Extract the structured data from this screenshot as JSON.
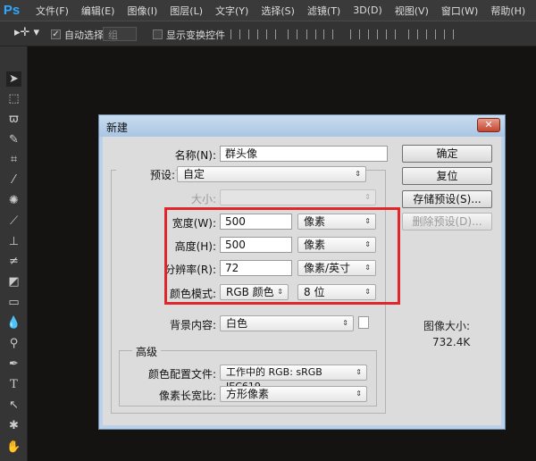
{
  "app": {
    "logo": "Ps",
    "menus": [
      "文件(F)",
      "编辑(E)",
      "图像(I)",
      "图层(L)",
      "文字(Y)",
      "选择(S)",
      "滤镜(T)",
      "3D(D)",
      "视图(V)",
      "窗口(W)",
      "帮助(H)"
    ]
  },
  "options": {
    "auto_select_label": "自动选择:",
    "auto_select_checked": true,
    "auto_select_value": "组",
    "show_transform_label": "显示变换控件",
    "show_transform_checked": false
  },
  "tools": [
    "move-icon",
    "marquee-icon",
    "lasso-icon",
    "quick-select-icon",
    "crop-icon",
    "eyedropper-icon",
    "healing-icon",
    "brush-icon",
    "stamp-icon",
    "history-brush-icon",
    "eraser-icon",
    "gradient-icon",
    "blur-icon",
    "dodge-icon",
    "pen-icon",
    "type-icon",
    "path-select-icon",
    "shape-icon",
    "hand-icon"
  ],
  "dialog": {
    "title": "新建",
    "name_label": "名称(N):",
    "name_value": "群头像",
    "preset_label": "预设:",
    "preset_value": "自定",
    "size_label": "大小:",
    "size_value": "",
    "width_label": "宽度(W):",
    "width_value": "500",
    "width_unit": "像素",
    "height_label": "高度(H):",
    "height_value": "500",
    "height_unit": "像素",
    "resolution_label": "分辨率(R):",
    "resolution_value": "72",
    "resolution_unit": "像素/英寸",
    "color_mode_label": "颜色模式:",
    "color_mode_value": "RGB 颜色",
    "bit_depth": "8 位",
    "background_label": "背景内容:",
    "background_value": "白色",
    "background_swatch": "#ffffff",
    "advanced_label": "高级",
    "profile_label": "颜色配置文件:",
    "profile_value": "工作中的 RGB: sRGB IEC619...",
    "aspect_label": "像素长宽比:",
    "aspect_value": "方形像素",
    "buttons": {
      "ok": "确定",
      "reset": "复位",
      "save_preset": "存储预设(S)...",
      "delete_preset": "删除预设(D)..."
    },
    "image_size_label": "图像大小:",
    "image_size_value": "732.4K",
    "highlight_color": "#e0252b"
  }
}
